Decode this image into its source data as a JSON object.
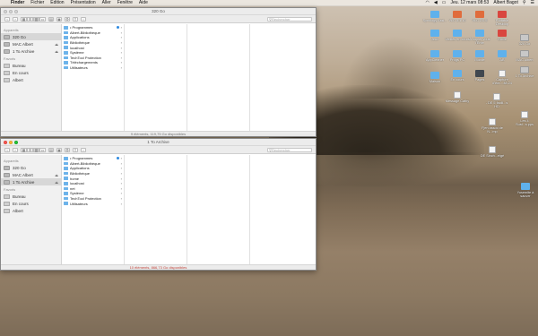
{
  "menubar": {
    "app": "Finder",
    "items": [
      "Fichier",
      "Édition",
      "Présentation",
      "Aller",
      "Fenêtre",
      "Aide"
    ],
    "datetime": "Jeu. 12 mars 08:53",
    "user": "Albert Bagot"
  },
  "window1": {
    "title": "320 Go",
    "search_placeholder": "Rechercher",
    "sidebar": {
      "devices_header": "Appareils",
      "devices": [
        {
          "label": "320 Go",
          "selected": true
        },
        {
          "label": "MAC Albert",
          "eject": "⏏"
        },
        {
          "label": "1 To Archive",
          "eject": "⏏"
        }
      ],
      "favorites_header": "Favoris",
      "favorites": [
        "Bureau",
        "En cours",
        "Albert"
      ]
    },
    "column": [
      "• Programmes",
      "Albert-Bibliothèque",
      "Applications",
      "Bibliothèque",
      "localhost",
      "Système",
      "TechTool Protection",
      "Téléchargements",
      "Utilisateurs"
    ],
    "status": "9 éléments, 119,75 Go disponibles"
  },
  "window2": {
    "title": "1 To Archive",
    "search_placeholder": "Rechercher",
    "sidebar": {
      "devices_header": "Appareils",
      "devices": [
        {
          "label": "320 Go"
        },
        {
          "label": "MAC Albert",
          "eject": "⏏"
        },
        {
          "label": "1 To Archive",
          "eject": "⏏",
          "selected": true
        }
      ],
      "favorites_header": "Favoris",
      "favorites": [
        "Bureau",
        "En cours",
        "Albert"
      ]
    },
    "column": [
      "• Programmes",
      "Albert-Bibliothèque",
      "Applications",
      "Bibliothèque",
      "home",
      "localhost",
      "net",
      "Système",
      "TechTool Protection",
      "Utilisateurs"
    ],
    "status": "10 éléments, 866,73 Go disponibles"
  },
  "desktop": {
    "icons": [
      {
        "label": "Synology Assi...",
        "kind": "folder"
      },
      {
        "label": "VLC 3.1.10",
        "kind": "app"
      },
      {
        "label": "VLC 2.0.5",
        "kind": "app"
      },
      {
        "label": "Portable Desktop",
        "kind": "red"
      },
      {
        "label": "Jeux",
        "kind": "folder"
      },
      {
        "label": "Vieilles en cours",
        "kind": "folder"
      },
      {
        "label": "À copier vous l'Ente",
        "kind": "folder"
      },
      {
        "label": "Gmile",
        "kind": "red"
      },
      {
        "label": "320 Go",
        "kind": "drive"
      },
      {
        "label": "AppCleaner",
        "kind": "folder"
      },
      {
        "label": "Progs PC",
        "kind": "folder"
      },
      {
        "label": "Mobile",
        "kind": "folder"
      },
      {
        "label": "AB",
        "kind": "folder"
      },
      {
        "label": "MAC Albert",
        "kind": "drive"
      },
      {
        "label": "Maison",
        "kind": "folder"
      },
      {
        "label": "En cours",
        "kind": "folder"
      },
      {
        "label": "Pages",
        "kind": "dark"
      },
      {
        "label": "1 To Archive",
        "kind": "drive"
      },
      {
        "label": "Capture d'écr....38.24",
        "kind": "doc"
      },
      {
        "label": "Message Cathy",
        "kind": "doc"
      },
      {
        "label": "- DE 5 facili...s HD",
        "kind": "doc"
      },
      {
        "label": "Les 4 Sust...s.pps",
        "kind": "doc"
      },
      {
        "label": "Fjen assoc de N...mp",
        "kind": "doc"
      },
      {
        "label": "DE Sinch...eigé",
        "kind": "doc"
      },
      {
        "label": "Yosemite à sauver",
        "kind": "folder"
      }
    ]
  }
}
